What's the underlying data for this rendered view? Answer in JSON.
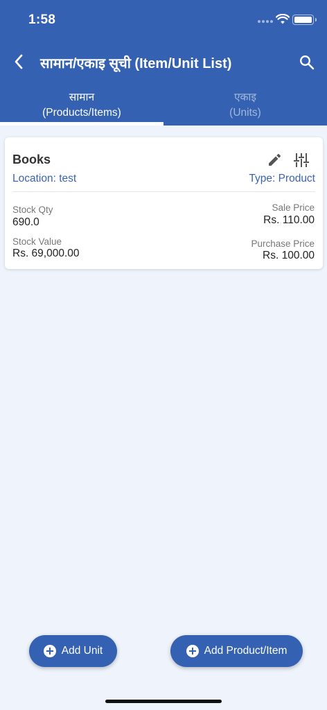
{
  "status_bar": {
    "time": "1:58"
  },
  "toolbar": {
    "title": "सामान/एकाइ सूची  (Item/Unit List)",
    "back_icon": "chevron-left-icon",
    "search_icon": "search-icon"
  },
  "tabs": [
    {
      "label_native": "सामान",
      "label_english": "(Products/Items)",
      "active": true
    },
    {
      "label_native": "एकाइ",
      "label_english": "(Units)",
      "active": false
    }
  ],
  "items": [
    {
      "name": "Books",
      "location": "Location: test",
      "type": "Type: Product",
      "stock_qty_label": "Stock Qty",
      "stock_qty": "690.0",
      "stock_value_label": "Stock Value",
      "stock_value": "Rs. 69,000.00",
      "sale_price_label": "Sale Price",
      "sale_price": "Rs. 110.00",
      "purchase_price_label": "Purchase Price",
      "purchase_price": "Rs. 100.00"
    }
  ],
  "actions": {
    "add_unit": "Add Unit",
    "add_product": "Add Product/Item"
  },
  "colors": {
    "primary": "#3461b1",
    "background": "#eef3fc",
    "accent_text": "#3b63b3"
  }
}
